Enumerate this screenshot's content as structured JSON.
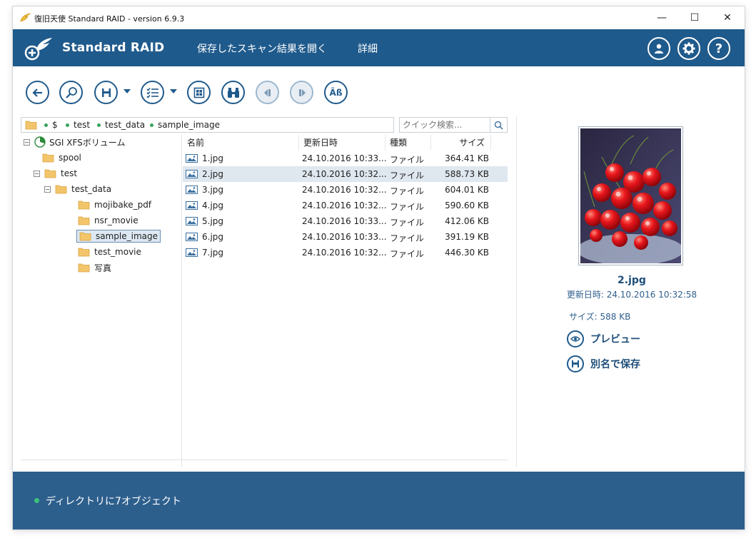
{
  "window": {
    "title": "復旧天使 Standard RAID - version 6.9.3",
    "controls": {
      "minimize": "—",
      "maximize": "☐",
      "close": "✕"
    }
  },
  "header": {
    "brand": "Standard RAID",
    "nav": [
      "保存したスキャン結果を開く",
      "詳細"
    ],
    "icons": [
      "user-icon",
      "gear-icon",
      "help-icon"
    ],
    "help_glyph": "?",
    "bg_color": "#1f5a8c"
  },
  "toolbar": {
    "buttons": [
      "back-icon",
      "search-zoom-icon",
      "save-icon",
      "list-icon",
      "grid-icon",
      "binoculars-icon",
      "prev-icon",
      "next-icon",
      "case-icon"
    ],
    "case_label": "Äß"
  },
  "path": {
    "segments": [
      "$",
      "test",
      "test_data",
      "sample_image"
    ]
  },
  "search": {
    "placeholder": "クイック検索..."
  },
  "tree": {
    "root": "SGI XFSボリューム",
    "expand": "−",
    "nodes": [
      "spool",
      "test",
      "test_data",
      "mojibake_pdf",
      "nsr_movie",
      "sample_image",
      "test_movie",
      "写真"
    ]
  },
  "files": {
    "columns": {
      "name": "名前",
      "date": "更新日時",
      "type": "種類",
      "size": "サイズ"
    },
    "rows": [
      {
        "name": "1.jpg",
        "date": "24.10.2016 10:33...",
        "type": "ファイル",
        "size": "364.41 KB"
      },
      {
        "name": "2.jpg",
        "date": "24.10.2016 10:32...",
        "type": "ファイル",
        "size": "588.73 KB"
      },
      {
        "name": "3.jpg",
        "date": "24.10.2016 10:32...",
        "type": "ファイル",
        "size": "604.01 KB"
      },
      {
        "name": "4.jpg",
        "date": "24.10.2016 10:32...",
        "type": "ファイル",
        "size": "590.60 KB"
      },
      {
        "name": "5.jpg",
        "date": "24.10.2016 10:33...",
        "type": "ファイル",
        "size": "412.06 KB"
      },
      {
        "name": "6.jpg",
        "date": "24.10.2016 10:33...",
        "type": "ファイル",
        "size": "391.19 KB"
      },
      {
        "name": "7.jpg",
        "date": "24.10.2016 10:32...",
        "type": "ファイル",
        "size": "446.30 KB"
      }
    ]
  },
  "details": {
    "filename": "2.jpg",
    "modified": "更新日時: 24.10.2016 10:32:58",
    "size": "サイズ: 588 KB",
    "actions": {
      "preview": "プレビュー",
      "save_as": "別名で保存"
    }
  },
  "status": {
    "text": "ディレクトリに7オブジェクト"
  }
}
